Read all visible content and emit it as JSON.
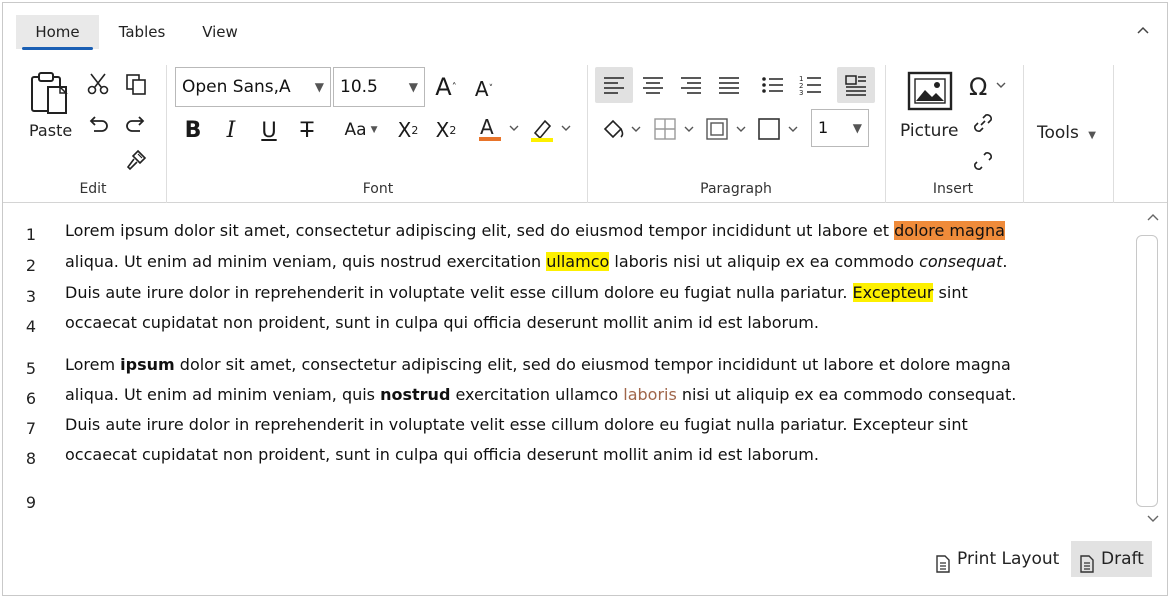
{
  "tabs": {
    "home": "Home",
    "tables": "Tables",
    "view": "View"
  },
  "ribbon": {
    "edit": {
      "paste_label": "Paste",
      "group_label": "Edit"
    },
    "font": {
      "font_family": "Open Sans,A",
      "font_size": "10.5",
      "size_index_label": "1",
      "group_label": "Font"
    },
    "paragraph": {
      "group_label": "Paragraph",
      "indent_value": "1"
    },
    "insert": {
      "picture_label": "Picture",
      "group_label": "Insert"
    },
    "tools": {
      "label": "Tools"
    }
  },
  "editor": {
    "line_numbers": [
      "1",
      "2",
      "3",
      "4",
      "5",
      "6",
      "7",
      "8",
      "9"
    ],
    "p1": {
      "l1_a": "Lorem ipsum dolor sit amet, consectetur adipiscing elit, sed do eiusmod tempor incididunt ut labore et ",
      "l1_hl": "dolore magna",
      "l2_a": "aliqua. Ut enim ad minim veniam, quis nostrud exercitation ",
      "l2_hl": "ullamco",
      "l2_b": " laboris nisi ut aliquip ex ea commodo ",
      "l2_i": "consequat",
      "l2_c": ".",
      "l3_a": "Duis aute irure dolor in reprehenderit in voluptate velit esse cillum dolore eu fugiat nulla pariatur. ",
      "l3_hl": "Excepteur",
      "l3_b": " sint",
      "l4": "occaecat cupidatat non proident, sunt in culpa qui officia deserunt mollit anim id est laborum."
    },
    "p2": {
      "l5_a": "Lorem ",
      "l5_b": "ipsum",
      "l5_c": " dolor sit amet, consectetur adipiscing elit, sed do eiusmod tempor incididunt ut labore et dolore magna",
      "l6_a": "aliqua. Ut enim ad minim veniam, quis ",
      "l6_b": "nostrud",
      "l6_c": " exercitation ullamco ",
      "l6_d": "laboris",
      "l6_e": " nisi ut aliquip ex ea commodo consequat.",
      "l7": "Duis aute irure dolor in reprehenderit in voluptate velit esse cillum dolore eu fugiat nulla pariatur. Excepteur sint",
      "l8": "occaecat cupidatat non proident, sunt in culpa qui officia deserunt mollit anim id est laborum."
    }
  },
  "status": {
    "print_layout": "Print Layout",
    "draft": "Draft"
  },
  "colors": {
    "accent": "#1a5fb4",
    "highlight_orange": "#ef8b3a",
    "highlight_yellow": "#fdf000",
    "font_color_bar": "#e8742a",
    "brown_text": "#a0664a"
  }
}
